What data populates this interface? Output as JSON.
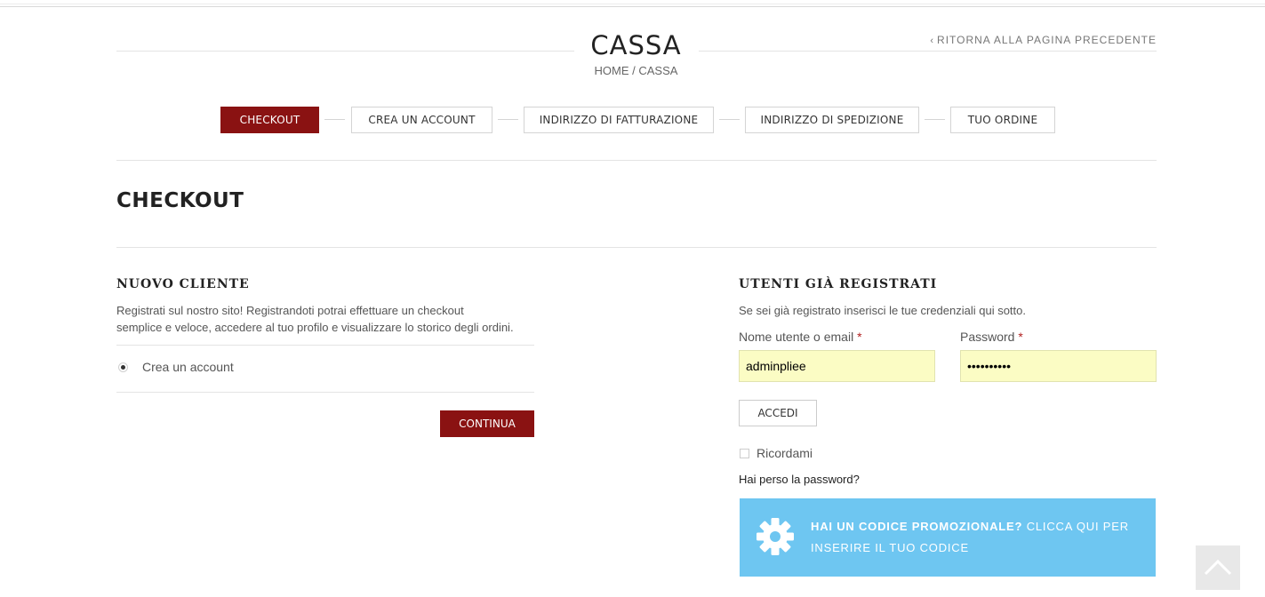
{
  "header": {
    "title": "CASSA",
    "breadcrumb": "HOME / CASSA",
    "back_link": "RITORNA ALLA PAGINA PRECEDENTE"
  },
  "steps": [
    {
      "label": "CHECKOUT",
      "active": true
    },
    {
      "label": "CREA UN ACCOUNT",
      "active": false
    },
    {
      "label": "INDIRIZZO DI FATTURAZIONE",
      "active": false
    },
    {
      "label": "INDIRIZZO DI SPEDIZIONE",
      "active": false
    },
    {
      "label": "TUO ORDINE",
      "active": false
    }
  ],
  "section_title": "CHECKOUT",
  "new_customer": {
    "title": "NUOVO CLIENTE",
    "description_line1": "Registrati sul nostro sito! Registrandoti potrai effettuare un checkout",
    "description_line2": "semplice e veloce, accedere al tuo profilo e visualizzare lo storico degli ordini.",
    "option_label": "Crea un account",
    "continue_label": "CONTINUA"
  },
  "registered": {
    "title": "UTENTI GIÀ REGISTRATI",
    "description": "Se sei già registrato inserisci le tue credenziali qui sotto.",
    "username_label": "Nome utente o email",
    "username_value": "adminpliee",
    "password_label": "Password",
    "password_value": "••••••••••",
    "required_mark": "*",
    "login_label": "ACCEDI",
    "remember_label": "Ricordami",
    "lost_password": "Hai perso la password?"
  },
  "promo": {
    "bold_text": "HAI UN CODICE PROMOZIONALE?",
    "text": "CLICCA QUI PER INSERIRE IL TUO CODICE"
  },
  "colors": {
    "accent": "#8a1212",
    "promo_bg": "#6ec6f1",
    "autofill_bg": "#fbfcc4"
  }
}
